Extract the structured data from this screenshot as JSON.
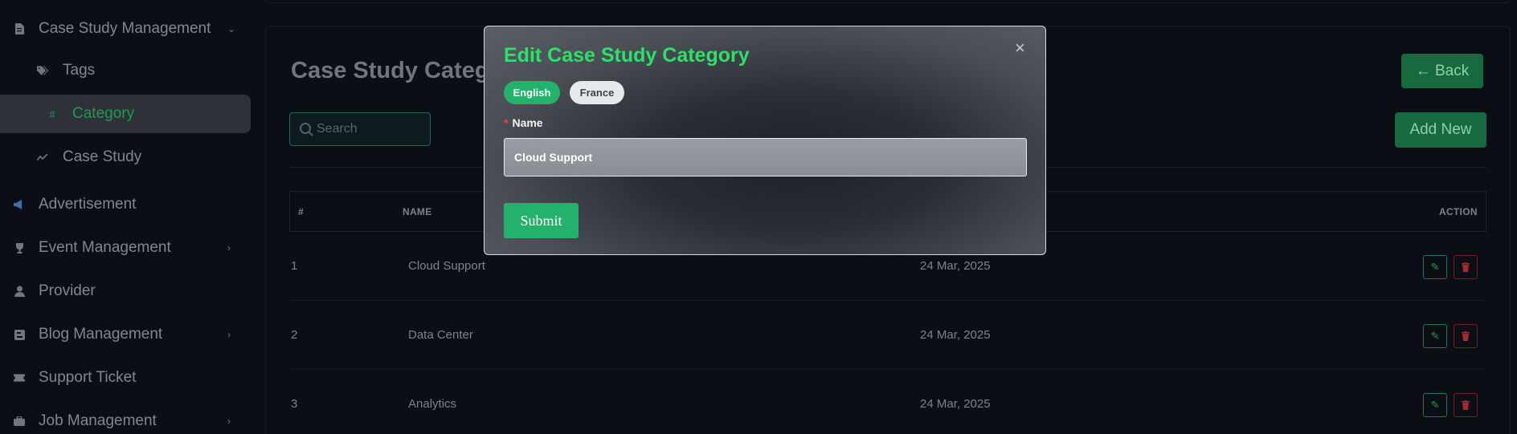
{
  "sidebar": {
    "items": [
      {
        "label": "Case Study Management",
        "icon": "document-icon",
        "has_chevron": true,
        "expanded": true
      },
      {
        "label": "Tags",
        "icon": "tags-icon"
      },
      {
        "label": "Category",
        "icon": "hashtag-icon",
        "active": true
      },
      {
        "label": "Case Study",
        "icon": "chart-line-icon"
      },
      {
        "label": "Advertisement",
        "icon": "megaphone-icon"
      },
      {
        "label": "Event Management",
        "icon": "trophy-icon",
        "has_chevron": true
      },
      {
        "label": "Provider",
        "icon": "user-icon"
      },
      {
        "label": "Blog Management",
        "icon": "blog-icon",
        "has_chevron": true
      },
      {
        "label": "Support Ticket",
        "icon": "ticket-icon"
      },
      {
        "label": "Job Management",
        "icon": "briefcase-icon",
        "has_chevron": true
      }
    ]
  },
  "page": {
    "title": "Case Study Categ",
    "back_label": "← Back",
    "add_new_label": "Add New",
    "search_placeholder": "Search"
  },
  "table": {
    "headers": {
      "num": "#",
      "name": "NAME",
      "action": "ACTION"
    },
    "rows": [
      {
        "num": "1",
        "name": "Cloud Support",
        "date": "24 Mar, 2025"
      },
      {
        "num": "2",
        "name": "Data Center",
        "date": "24 Mar, 2025"
      },
      {
        "num": "3",
        "name": "Analytics",
        "date": "24 Mar, 2025"
      }
    ]
  },
  "modal": {
    "title": "Edit Case Study Category",
    "close": "×",
    "languages": [
      {
        "label": "English",
        "selected": true
      },
      {
        "label": "France",
        "selected": false
      }
    ],
    "required_mark": "*",
    "name_label": "Name",
    "name_value": "Cloud Support",
    "submit_label": "Submit"
  },
  "colors": {
    "accent": "#23b26b",
    "title_green": "#2ee06a",
    "danger": "#a32a30",
    "background": "#0a0d14"
  }
}
